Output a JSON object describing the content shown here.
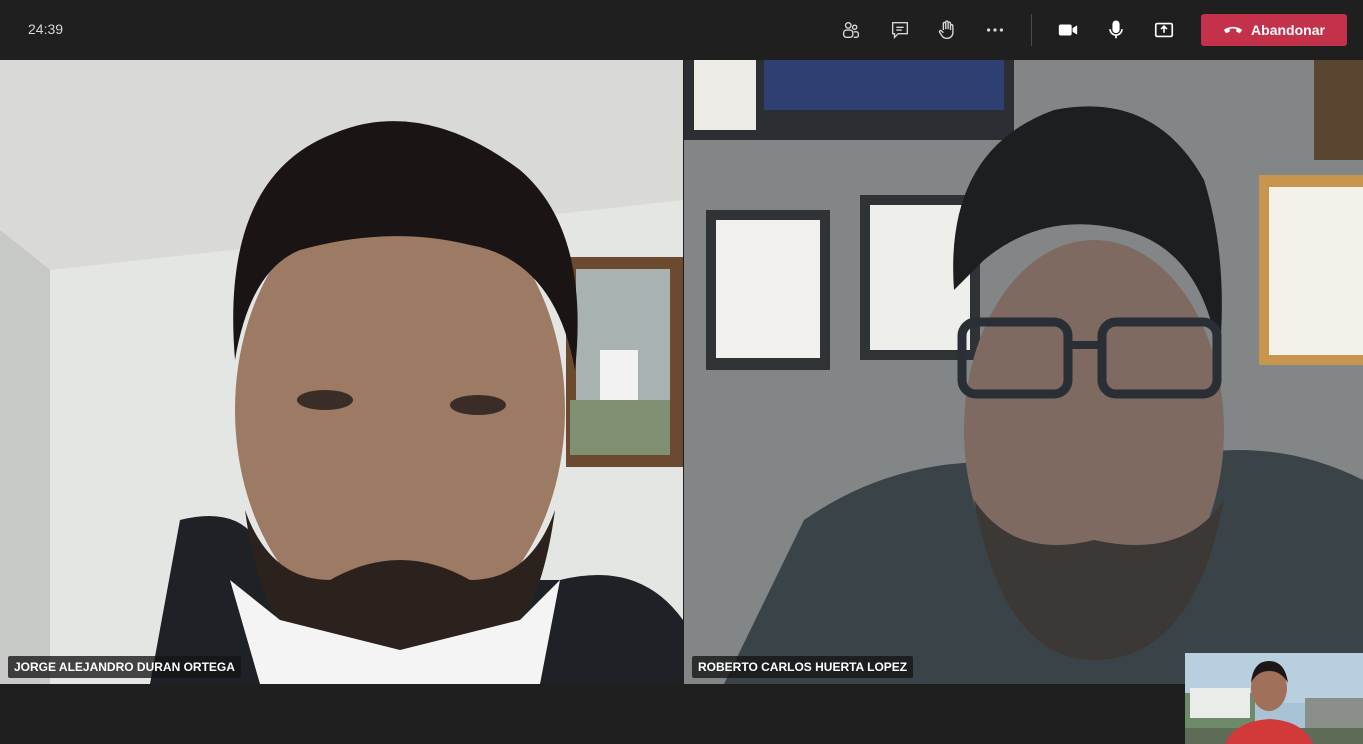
{
  "call": {
    "duration": "24:39"
  },
  "toolbar": {
    "participants_icon": "participants-icon",
    "chat_icon": "chat-icon",
    "raise_hand_icon": "raise-hand-icon",
    "more_icon": "more-options-icon",
    "camera_icon": "camera-icon",
    "mic_icon": "microphone-icon",
    "share_icon": "share-screen-icon",
    "leave_label": "Abandonar",
    "leave_icon": "hang-up-icon",
    "leave_color": "#c4314b"
  },
  "participants": [
    {
      "name": "JORGE ALEJANDRO DURAN ORTEGA"
    },
    {
      "name": "ROBERTO CARLOS HUERTA LOPEZ"
    }
  ]
}
